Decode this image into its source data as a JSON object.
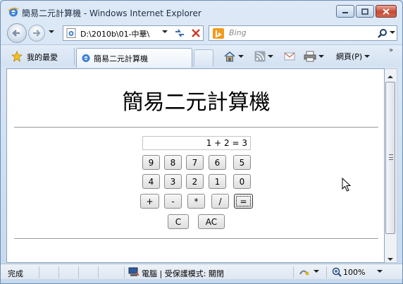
{
  "window": {
    "title": "簡易二元計算機 - Windows Internet Explorer"
  },
  "address": {
    "url": "D:\\2010b\\01-中華\\"
  },
  "search": {
    "placeholder": "Bing"
  },
  "favorites": {
    "label": "我的最愛"
  },
  "tabs": [
    {
      "label": "簡易二元計算機"
    }
  ],
  "commandbar": {
    "page_label": "網頁(P)"
  },
  "page": {
    "heading": "簡易二元計算機",
    "display_value": "1 + 2 = 3",
    "keys": {
      "row1": [
        "9",
        "8",
        "7",
        "6",
        "5"
      ],
      "row2": [
        "4",
        "3",
        "2",
        "1",
        "0"
      ],
      "row3": [
        "+",
        "-",
        "*",
        "/",
        "="
      ],
      "row4": [
        "C",
        "AC"
      ]
    }
  },
  "status": {
    "text": "完成",
    "zone": "電腦 | 受保護模式: 關閉",
    "zoom": "100%"
  }
}
